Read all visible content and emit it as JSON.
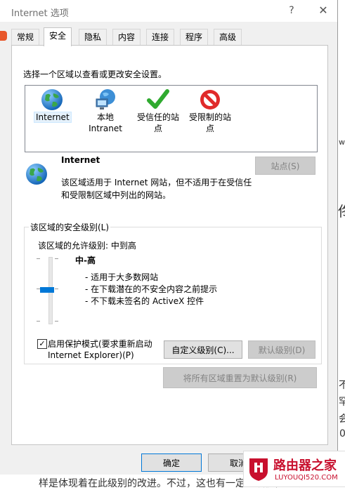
{
  "window": {
    "title": "Internet 选项",
    "help_symbol": "?",
    "close_symbol": "✕"
  },
  "tabs": [
    {
      "label": "常规",
      "active": false
    },
    {
      "label": "安全",
      "active": true
    },
    {
      "label": "隐私",
      "active": false
    },
    {
      "label": "内容",
      "active": false
    },
    {
      "label": "连接",
      "active": false
    },
    {
      "label": "程序",
      "active": false
    },
    {
      "label": "高级",
      "active": false
    }
  ],
  "security": {
    "select_zone_prompt": "选择一个区域以查看或更改安全设置。",
    "zones": [
      {
        "label": "Internet",
        "icon": "globe-icon",
        "selected": true
      },
      {
        "label_line1": "本地",
        "label_line2": "Intranet",
        "icon": "intranet-icon"
      },
      {
        "label_line1": "受信任的站",
        "label_line2": "点",
        "icon": "checkmark-icon"
      },
      {
        "label_line1": "受限制的站",
        "label_line2": "点",
        "icon": "restricted-icon"
      }
    ],
    "selected_zone_title": "Internet",
    "selected_zone_desc_line1": "该区域适用于 Internet 网站，但不适用于在受信任",
    "selected_zone_desc_line2": "和受限制区域中列出的网站。",
    "sites_button": "站点(S)",
    "level_group_title": "该区域的安全级别(L)",
    "allowed_levels": "该区域的允许级别: 中到高",
    "level_name": "中-高",
    "level_bullets": [
      "- 适用于大多数网站",
      "- 在下载潜在的不安全内容之前提示",
      "- 不下载未签名的 ActiveX 控件"
    ],
    "slider_level_index": 2,
    "slider_levels": 4,
    "protected_mode_checked": true,
    "protected_mode_line1": "启用保护模式(要求重新启动",
    "protected_mode_line2": "Internet Explorer)(P)",
    "custom_level_button": "自定义级别(C)...",
    "default_level_button": "默认级别(D)",
    "reset_all_button": "将所有区域重置为默认级别(R)"
  },
  "footer": {
    "ok_button": "确定",
    "cancel_button": "取消"
  },
  "background": {
    "right_fragments": [
      "ws",
      "佟",
      "不",
      "罕",
      "会",
      "0"
    ],
    "bottom_text": "样是体现着在此级别的改进。不过，这也有一定的硬伤，一截"
  },
  "watermark": {
    "brand": "路由器之家",
    "url": "LUYOUQI520.COM"
  },
  "colors": {
    "accent": "#0078d7",
    "watermark_red": "#c8102e"
  }
}
